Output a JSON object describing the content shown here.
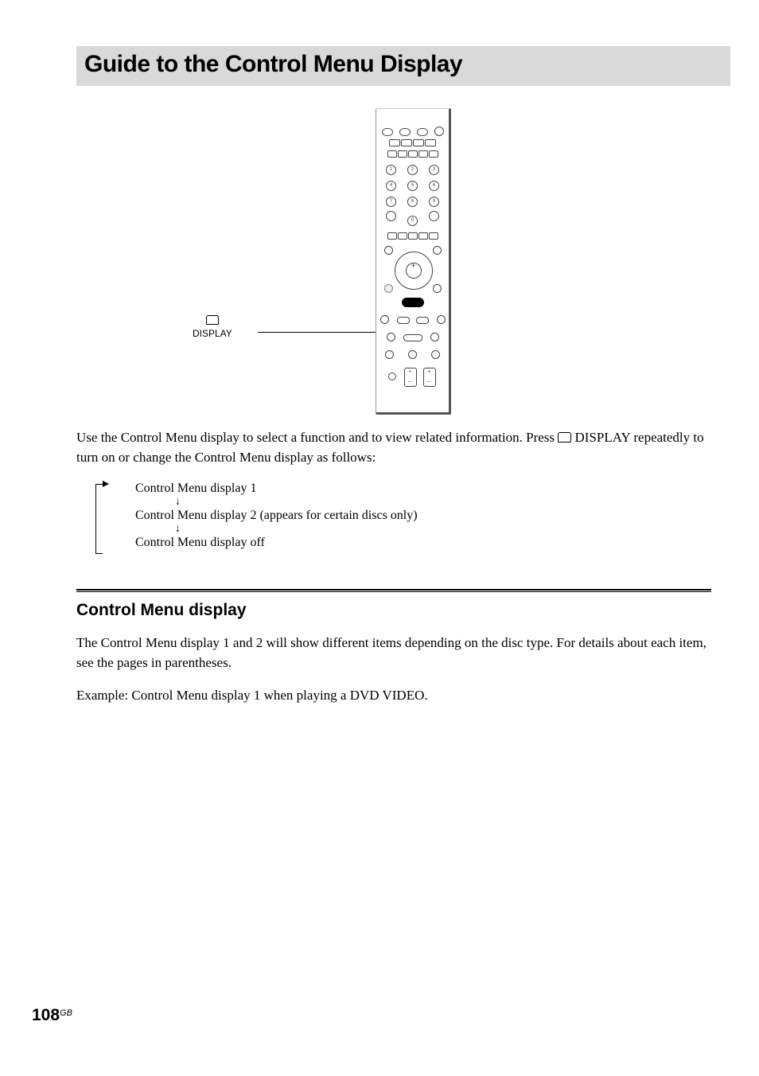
{
  "header": {
    "title": "Guide to the Control Menu Display"
  },
  "remote": {
    "label": "DISPLAY",
    "label_icon": "display-icon",
    "numpad": {
      "row1": [
        "1",
        "2",
        "3"
      ],
      "row2": [
        "4",
        "5",
        "6"
      ],
      "row3": [
        "7",
        "8",
        "9"
      ],
      "row4": [
        "",
        "0",
        ""
      ]
    },
    "highlighted_button_name": "display-button"
  },
  "body": {
    "intro_a": "Use the Control Menu display to select a function and to view related information. Press ",
    "intro_b": " DISPLAY repeatedly to turn on or change the Control Menu display as follows:"
  },
  "cycle": {
    "line1": "Control Menu display 1",
    "line2": "Control Menu display 2 (appears for certain discs only)",
    "line3": "Control Menu display off",
    "down_arrow": "↓"
  },
  "section": {
    "heading": "Control Menu display",
    "p1": "The Control Menu display 1 and 2 will show different items depending on the disc type. For details about each item, see the pages in parentheses.",
    "example": "Example: Control Menu display 1 when playing a DVD VIDEO."
  },
  "footer": {
    "page_number": "108",
    "page_suffix": "GB"
  }
}
